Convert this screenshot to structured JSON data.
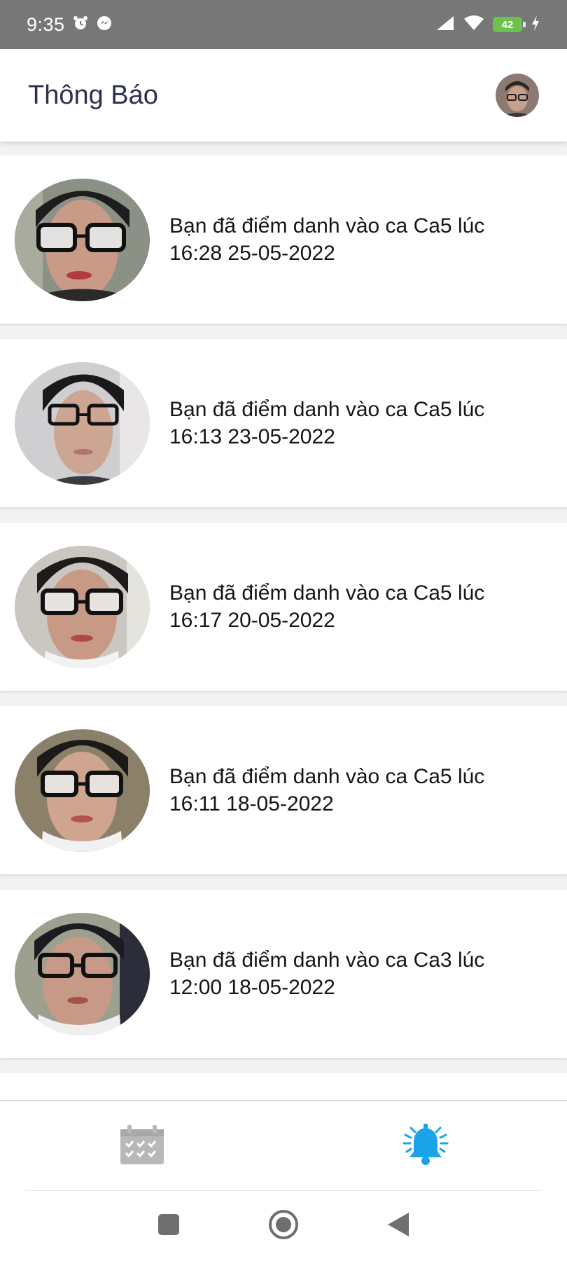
{
  "status_bar": {
    "time": "9:35",
    "battery_level": "42",
    "icons": [
      "alarm-icon",
      "messenger-icon",
      "signal-icon",
      "wifi-icon",
      "battery-icon",
      "charging-icon"
    ]
  },
  "header": {
    "title": "Thông Báo"
  },
  "notifications": [
    {
      "message": "Bạn đã điểm danh vào ca Ca5 lúc 16:28 25-05-2022"
    },
    {
      "message": "Bạn đã điểm danh vào ca Ca5 lúc 16:13 23-05-2022"
    },
    {
      "message": "Bạn đã điểm danh vào ca Ca5 lúc 16:17 20-05-2022"
    },
    {
      "message": "Bạn đã điểm danh vào ca Ca5 lúc 16:11 18-05-2022"
    },
    {
      "message": "Bạn đã điểm danh vào ca Ca3 lúc 12:00 18-05-2022"
    }
  ],
  "bottom_nav": {
    "items": [
      "calendar-icon",
      "notification-bell-icon"
    ],
    "active": "notification-bell-icon",
    "active_color": "#1aa3e8",
    "inactive_color": "#b8b8b8"
  },
  "system_nav": {
    "items": [
      "recents-square-icon",
      "home-circle-icon",
      "back-triangle-icon"
    ]
  }
}
